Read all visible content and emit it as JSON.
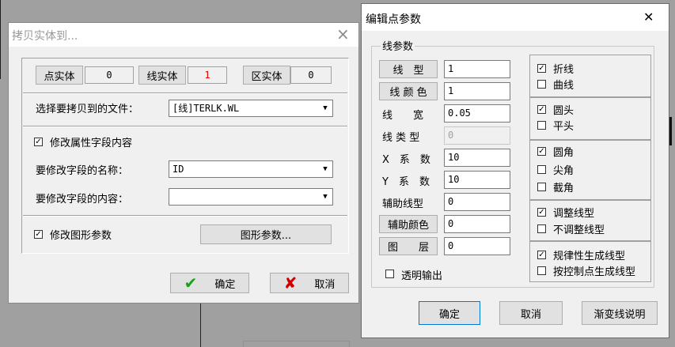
{
  "background": {
    "color": "#a0a0a0"
  },
  "copy_dialog": {
    "title": "拷贝实体到...",
    "close_glyph": "×",
    "point_label": "点实体",
    "point_count": "0",
    "line_label": "线实体",
    "line_count": "1",
    "area_label": "区实体",
    "area_count": "0",
    "target_file_label": "选择要拷贝到的文件：",
    "target_file_value": "[线]TERLK.WL",
    "modify_attr_label": "修改属性字段内容",
    "modify_attr_checked": true,
    "field_name_label": "要修改字段的名称：",
    "field_name_value": "ID",
    "field_content_label": "要修改字段的内容：",
    "field_content_value": "",
    "modify_graphic_label": "修改图形参数",
    "modify_graphic_checked": true,
    "graphic_params_button": "图形参数...",
    "ok_label": "确定",
    "cancel_label": "取消"
  },
  "edit_dialog": {
    "title": "编辑点参数",
    "close_glyph": "✕",
    "group_title": "线参数",
    "line_type_button": "线　型",
    "line_type_value": "1",
    "line_color_button": "线 颜 色",
    "line_color_value": "1",
    "line_width_label": "线　　宽",
    "line_width_value": "0.05",
    "line_kind_label": "线 类 型",
    "line_kind_value": "0",
    "x_coef_label": "X　系　数",
    "x_coef_value": "10",
    "y_coef_label": "Y　系　数",
    "y_coef_value": "10",
    "aux_type_label": "辅助线型",
    "aux_type_value": "0",
    "aux_color_button": "辅助颜色",
    "aux_color_value": "0",
    "layer_button": "图　　层",
    "layer_value": "0",
    "transparent_label": "透明输出",
    "options": [
      {
        "label": "折线",
        "checked": true
      },
      {
        "label": "曲线",
        "checked": false
      },
      {
        "label": "圆头",
        "checked": true
      },
      {
        "label": "平头",
        "checked": false
      },
      {
        "label": "圆角",
        "checked": true
      },
      {
        "label": "尖角",
        "checked": false
      },
      {
        "label": "截角",
        "checked": false
      },
      {
        "label": "调整线型",
        "checked": true
      },
      {
        "label": "不调整线型",
        "checked": false
      },
      {
        "label": "规律性生成线型",
        "checked": true
      },
      {
        "label": "按控制点生成线型",
        "checked": false
      }
    ],
    "ok_label": "确定",
    "cancel_label": "取消",
    "gradient_help_label": "渐变线说明"
  },
  "colors": {
    "red_value": "#e00000",
    "accent_blue": "#0078d7",
    "check_green": "#1aa01a",
    "cancel_red": "#cc0000"
  }
}
